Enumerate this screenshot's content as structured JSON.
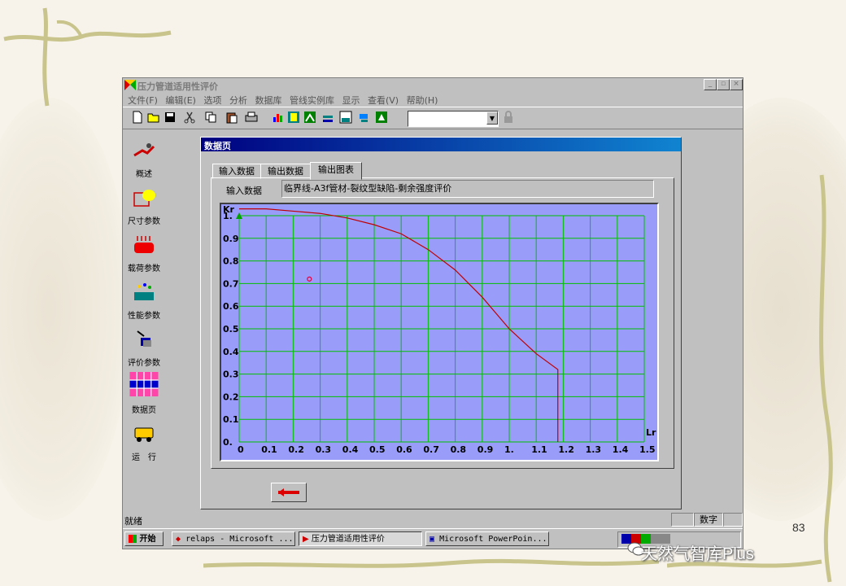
{
  "app": {
    "title": "压力管道适用性评价",
    "window_buttons": [
      "_",
      "▫",
      "×"
    ]
  },
  "menu": [
    "文件(F)",
    "编辑(E)",
    "选项",
    "分析",
    "数据库",
    "管线实例库",
    "显示",
    "查看(V)",
    "帮助(H)"
  ],
  "sidebar": {
    "items": [
      {
        "label": "概述",
        "icon": "overview-icon"
      },
      {
        "label": "尺寸参数",
        "icon": "dimension-icon"
      },
      {
        "label": "载荷参数",
        "icon": "load-icon"
      },
      {
        "label": "性能参数",
        "icon": "material-icon"
      },
      {
        "label": "评价参数",
        "icon": "evaluation-icon"
      },
      {
        "label": "数据页",
        "icon": "datasheet-icon"
      },
      {
        "label": "运　行",
        "icon": "run-icon"
      }
    ]
  },
  "child_window": {
    "title": "数据页",
    "tabs": [
      "输入数据",
      "输出数据",
      "输出图表"
    ],
    "active_tab": "输出图表",
    "input_label": "输入数据",
    "input_value": "临界线-A3f管材-裂纹型缺陷-剩余强度评价"
  },
  "chart_data": {
    "type": "line",
    "title": "",
    "xlabel": "Lr",
    "ylabel": "Kr",
    "xlim": [
      0,
      1.5
    ],
    "ylim": [
      0,
      1.0
    ],
    "grid": true,
    "x_ticks": [
      "0",
      "0.1",
      "0.2",
      "0.3",
      "0.4",
      "0.5",
      "0.6",
      "0.7",
      "0.8",
      "0.9",
      "1.",
      "1.1",
      "1.2",
      "1.3",
      "1.4",
      "1.5"
    ],
    "y_ticks": [
      "0.",
      "0.1",
      "0.2",
      "0.3",
      "0.4",
      "0.5",
      "0.6",
      "0.7",
      "0.8",
      "0.9",
      "1."
    ],
    "series": [
      {
        "x": [
          0,
          0.1,
          0.2,
          0.3,
          0.4,
          0.5,
          0.6,
          0.7,
          0.8,
          0.9,
          1.0,
          1.1,
          1.18,
          1.18
        ],
        "y": [
          1.03,
          1.03,
          1.02,
          1.01,
          0.99,
          0.96,
          0.92,
          0.85,
          0.76,
          0.64,
          0.5,
          0.39,
          0.32,
          0.0
        ]
      }
    ],
    "points": [
      {
        "x": 0.26,
        "y": 0.72
      }
    ],
    "colors": {
      "background": "#9a9cfa",
      "grid": "#00c000",
      "curve": "#c00000",
      "point": "#e00040"
    }
  },
  "status": {
    "text": "就绪",
    "panel": "数字"
  },
  "taskbar": {
    "start": "开始",
    "tasks": [
      "relaps - Microsoft ...",
      "压力管道适用性评价",
      "Microsoft PowerPoin..."
    ]
  },
  "slide": {
    "page_number": "83",
    "brand": "天然气智库Plus"
  }
}
